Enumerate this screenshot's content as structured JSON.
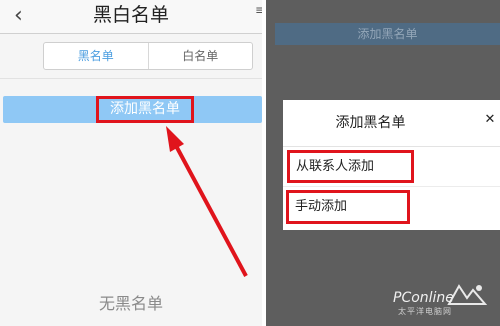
{
  "left": {
    "title": "黑白名单",
    "back_icon": "chevron-left-icon",
    "tabs": [
      {
        "label": "黑名单",
        "active": true
      },
      {
        "label": "白名单",
        "active": false
      }
    ],
    "add_button_label": "添加黑名单",
    "empty_text": "无黑名单"
  },
  "right": {
    "background_button_label": "添加黑名单",
    "dialog": {
      "title": "添加黑名单",
      "options": [
        {
          "label": "从联系人添加"
        },
        {
          "label": "手动添加"
        }
      ]
    }
  },
  "watermark": {
    "brand": "PConline",
    "subtitle": "太平洋电脑网"
  },
  "colors": {
    "accent_blue": "#4c9ee0",
    "add_bar": "#8fc8f5",
    "highlight_red": "#e0141c",
    "overlay": "#5e5e5e"
  }
}
